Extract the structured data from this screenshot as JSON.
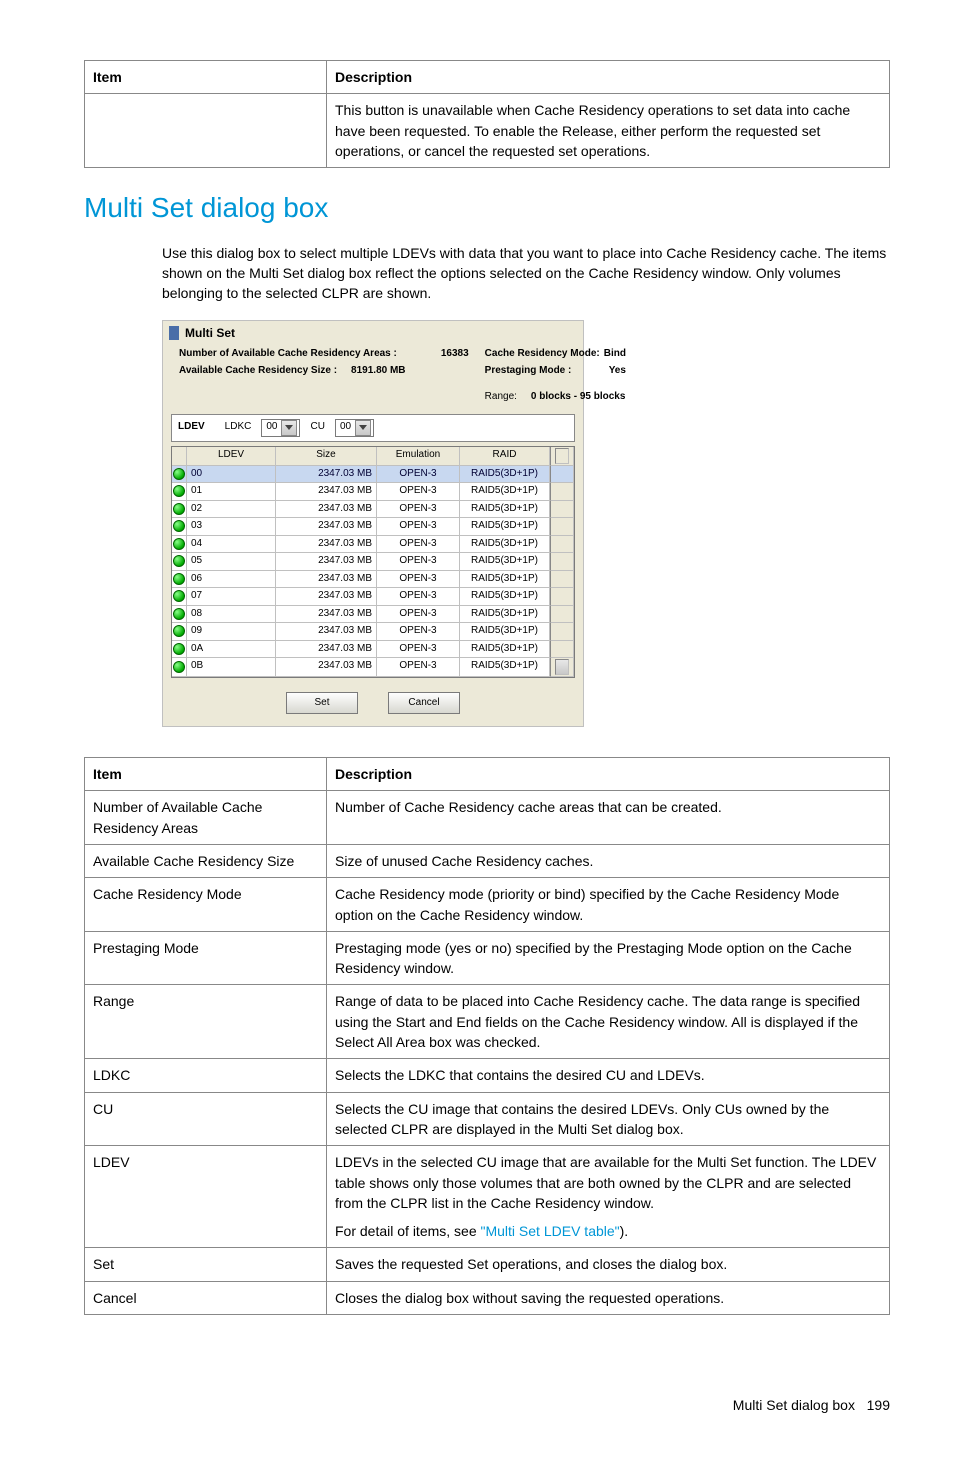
{
  "topTable": {
    "headers": [
      "Item",
      "Description"
    ],
    "row": {
      "item": "",
      "desc": "This button is unavailable when Cache Residency operations to set data into cache have been requested. To enable the Release, either perform the requested set operations, or cancel the requested set operations."
    }
  },
  "heading": "Multi Set dialog box",
  "intro": "Use this dialog box to select multiple LDEVs with data that you want to place into Cache Residency cache. The items shown on the Multi Set dialog box reflect the options selected on the Cache Residency window. Only volumes belonging to the selected CLPR are shown.",
  "dialog": {
    "title": "Multi Set",
    "numAreasLabel": "Number of Available Cache Residency Areas :",
    "numAreasVal": "16383",
    "availSizeLabel": "Available Cache Residency Size :",
    "availSizeVal": "8191.80 MB",
    "modeLabel": "Cache Residency Mode:",
    "modeVal": "Bind",
    "prestageLabel": "Prestaging Mode  :",
    "prestageVal": "Yes",
    "rangeLabel": "Range:",
    "rangeVal": "0 blocks - 95 blocks",
    "ldevLabel": "LDEV",
    "ldkcLabel": "LDKC",
    "ldkcVal": "00",
    "cuLabel": "CU",
    "cuVal": "00",
    "gridHeaders": [
      "LDEV",
      "Size",
      "Emulation",
      "RAID"
    ],
    "rows": [
      {
        "ldev": "00",
        "size": "2347.03 MB",
        "emul": "OPEN-3",
        "raid": "RAID5(3D+1P)",
        "selected": true
      },
      {
        "ldev": "01",
        "size": "2347.03 MB",
        "emul": "OPEN-3",
        "raid": "RAID5(3D+1P)"
      },
      {
        "ldev": "02",
        "size": "2347.03 MB",
        "emul": "OPEN-3",
        "raid": "RAID5(3D+1P)"
      },
      {
        "ldev": "03",
        "size": "2347.03 MB",
        "emul": "OPEN-3",
        "raid": "RAID5(3D+1P)"
      },
      {
        "ldev": "04",
        "size": "2347.03 MB",
        "emul": "OPEN-3",
        "raid": "RAID5(3D+1P)"
      },
      {
        "ldev": "05",
        "size": "2347.03 MB",
        "emul": "OPEN-3",
        "raid": "RAID5(3D+1P)"
      },
      {
        "ldev": "06",
        "size": "2347.03 MB",
        "emul": "OPEN-3",
        "raid": "RAID5(3D+1P)"
      },
      {
        "ldev": "07",
        "size": "2347.03 MB",
        "emul": "OPEN-3",
        "raid": "RAID5(3D+1P)"
      },
      {
        "ldev": "08",
        "size": "2347.03 MB",
        "emul": "OPEN-3",
        "raid": "RAID5(3D+1P)"
      },
      {
        "ldev": "09",
        "size": "2347.03 MB",
        "emul": "OPEN-3",
        "raid": "RAID5(3D+1P)"
      },
      {
        "ldev": "0A",
        "size": "2347.03 MB",
        "emul": "OPEN-3",
        "raid": "RAID5(3D+1P)"
      },
      {
        "ldev": "0B",
        "size": "2347.03 MB",
        "emul": "OPEN-3",
        "raid": "RAID5(3D+1P)"
      }
    ],
    "setBtn": "Set",
    "cancelBtn": "Cancel"
  },
  "descTable": {
    "headers": [
      "Item",
      "Description"
    ],
    "rows": [
      {
        "item": "Number of Available Cache Residency Areas",
        "desc": "Number of Cache Residency cache areas that can be created."
      },
      {
        "item": "Available Cache Residency Size",
        "desc": "Size of unused Cache Residency caches."
      },
      {
        "item": "Cache Residency Mode",
        "desc": "Cache Residency mode (priority or bind) specified by the Cache Residency Mode option on the Cache Residency window."
      },
      {
        "item": "Prestaging Mode",
        "desc": "Prestaging mode (yes or no) specified by the Prestaging Mode option on the Cache Residency window."
      },
      {
        "item": "Range",
        "desc": "Range of data to be placed into Cache Residency cache. The data range is specified using the Start and End fields on the Cache Residency window. All is displayed if the Select All Area box was checked."
      },
      {
        "item": "LDKC",
        "desc": "Selects the LDKC that contains the desired CU and LDEVs."
      },
      {
        "item": "CU",
        "desc": "Selects the CU image that contains the desired LDEVs. Only CUs owned by the selected CLPR are displayed in the Multi Set dialog box."
      },
      {
        "item": "LDEV",
        "desc": "LDEVs in the selected CU image that are available for the Multi Set function. The LDEV table shows only those volumes that are both owned by the CLPR and are selected from the CLPR list in the Cache Residency window.",
        "extra": "For detail of items, see ",
        "link": "\"Multi Set LDEV table\"",
        "after": ")."
      },
      {
        "item": "Set",
        "desc": "Saves the requested Set operations, and closes the dialog box."
      },
      {
        "item": "Cancel",
        "desc": "Closes the dialog box without saving the requested operations."
      }
    ]
  },
  "footer": {
    "text": "Multi Set dialog box",
    "page": "199"
  }
}
